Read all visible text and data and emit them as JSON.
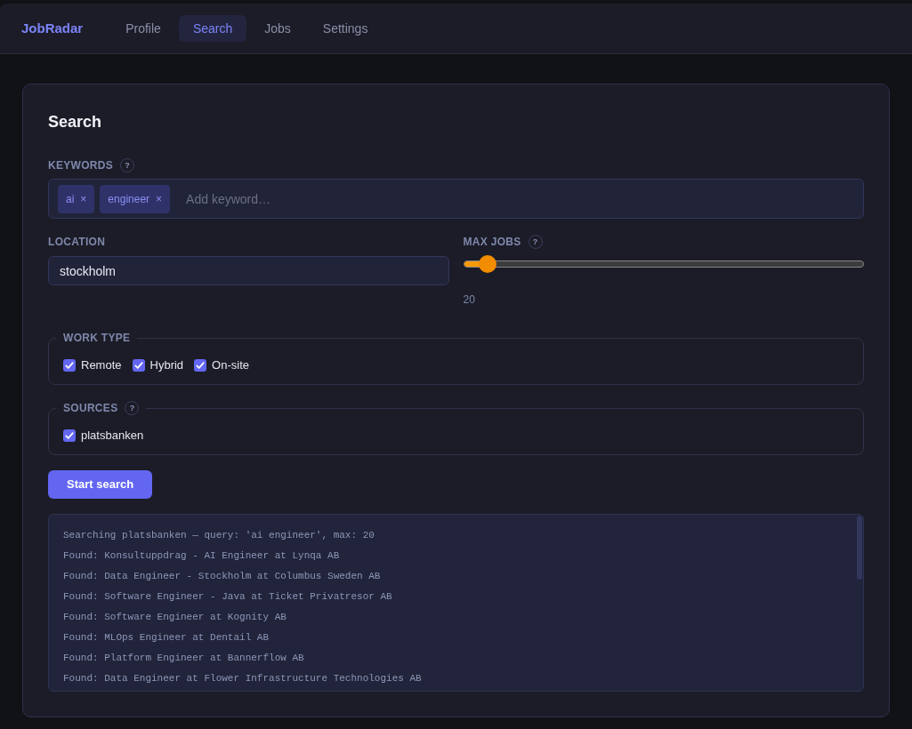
{
  "nav": {
    "brand": "JobRadar",
    "tabs": [
      {
        "label": "Profile",
        "selected": false
      },
      {
        "label": "Search",
        "selected": true
      },
      {
        "label": "Jobs",
        "selected": false
      },
      {
        "label": "Settings",
        "selected": false
      }
    ]
  },
  "search": {
    "title": "Search",
    "keywords": {
      "label": "KEYWORDS",
      "help": "?",
      "tags": [
        {
          "text": "ai",
          "remove": "×"
        },
        {
          "text": "engineer",
          "remove": "×"
        }
      ],
      "placeholder": "Add keyword…"
    },
    "location": {
      "label": "LOCATION",
      "value": "stockholm"
    },
    "max_jobs": {
      "label": "MAX JOBS",
      "help": "?",
      "level": 0.06,
      "reading": "20"
    },
    "work_type": {
      "legend": "WORK TYPE",
      "options": [
        {
          "label": "Remote",
          "checked": true
        },
        {
          "label": "Hybrid",
          "checked": true
        },
        {
          "label": "On-site",
          "checked": true
        }
      ]
    },
    "sources": {
      "legend": "SOURCES",
      "help": "?",
      "options": [
        {
          "label": "platsbanken",
          "checked": true
        }
      ]
    },
    "start_button": "Start search",
    "log": [
      "Searching platsbanken — query: 'ai engineer', max: 20",
      "Found: Konsultuppdrag - AI Engineer at Lynqa AB",
      "Found: Data Engineer - Stockholm at Columbus Sweden AB",
      "Found: Software Engineer - Java at Ticket Privatresor AB",
      "Found: Software Engineer at Kognity AB",
      "Found: MLOps Engineer at Dentail AB",
      "Found: Platform Engineer at Bannerflow AB",
      "Found: Data Engineer at Flower Infrastructure Technologies AB"
    ]
  }
}
